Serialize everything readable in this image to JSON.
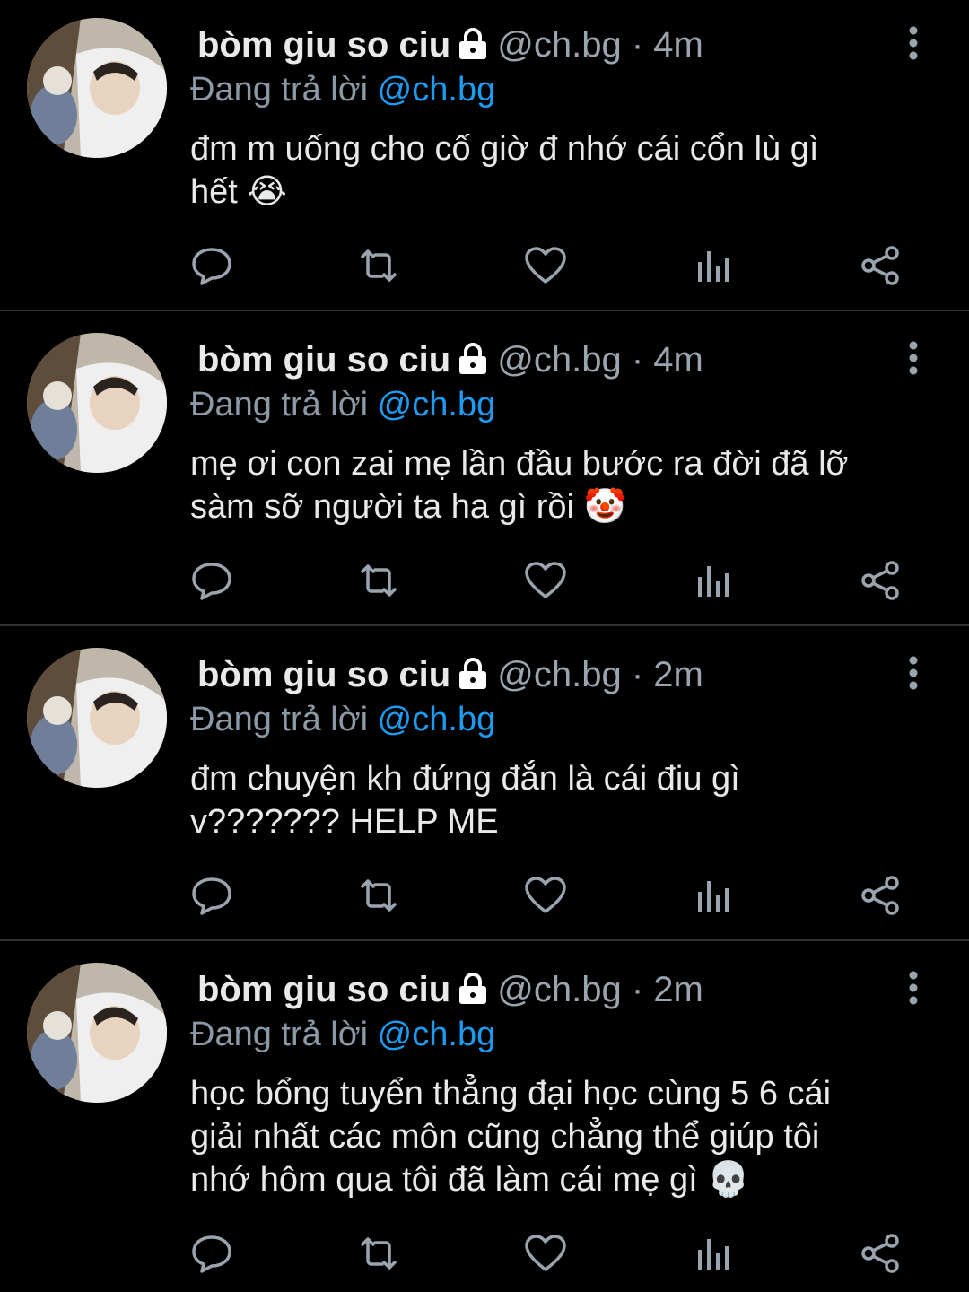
{
  "tweets": [
    {
      "name": "bòm giu so ciu",
      "handle": "@ch.bg",
      "separator": "·",
      "time": "4m",
      "reply_prefix": "Đang trả lời",
      "reply_to": "@ch.bg",
      "text_lines": [
        "đm m uống cho cố giờ đ nhớ cái cổn lù gì",
        "hết 😭"
      ]
    },
    {
      "name": "bòm giu so ciu",
      "handle": "@ch.bg",
      "separator": "·",
      "time": "4m",
      "reply_prefix": "Đang trả lời",
      "reply_to": "@ch.bg",
      "text_lines": [
        "mẹ ơi con zai mẹ lần đầu bước ra đời đã lỡ",
        "sàm sỡ người ta ha gì rồi 🤡"
      ]
    },
    {
      "name": "bòm giu so ciu",
      "handle": "@ch.bg",
      "separator": "·",
      "time": "2m",
      "reply_prefix": "Đang trả lời",
      "reply_to": "@ch.bg",
      "text_lines": [
        "đm chuyện kh đứng đắn là cái điu gì",
        "v??????? HELP ME"
      ]
    },
    {
      "name": "bòm giu so ciu",
      "handle": "@ch.bg",
      "separator": "·",
      "time": "2m",
      "reply_prefix": "Đang trả lời",
      "reply_to": "@ch.bg",
      "text_lines": [
        "học bổng tuyển thẳng đại học cùng 5 6 cái",
        "giải nhất các môn cũng chẳng thể giúp tôi",
        "nhớ hôm qua tôi đã làm cái mẹ gì 💀"
      ]
    }
  ],
  "icons": {
    "reply": "speech-bubble-icon",
    "retweet": "retweet-icon",
    "like": "heart-icon",
    "views": "bar-chart-icon",
    "share": "share-icon",
    "more": "vertical-dots-icon",
    "lock": "lock-icon"
  },
  "colors": {
    "background": "#000000",
    "text": "#e7e9ea",
    "muted": "#9aa4ae",
    "mention": "#1d9bf0",
    "divider": "#2f3336"
  }
}
